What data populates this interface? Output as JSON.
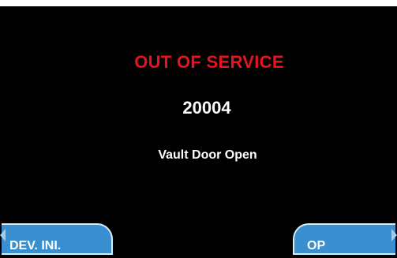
{
  "screen": {
    "title": "OUT OF SERVICE",
    "code": "20004",
    "message": "Vault Door Open"
  },
  "function_keys": {
    "left_label": "DEV. INI.",
    "right_label": "OP"
  },
  "colors": {
    "background": "#000000",
    "title": "#e8141c",
    "text": "#ffffff",
    "key_fill": "#3a8fd0",
    "key_border": "#d8ecf8"
  },
  "icons": {
    "left_arrow": "triangle-left-icon",
    "right_arrow": "triangle-right-icon"
  }
}
